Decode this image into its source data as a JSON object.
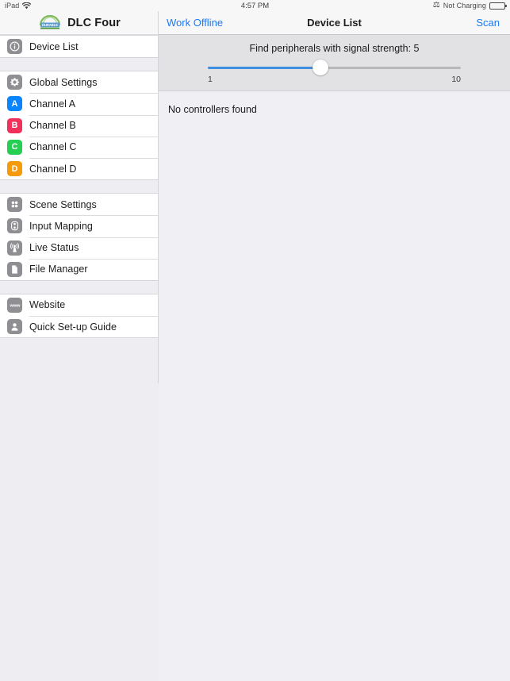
{
  "statusbar": {
    "device_label": "iPad",
    "wifi_icon": "wifi-icon",
    "time": "4:57 PM",
    "bluetooth_icon": "bluetooth-icon",
    "charging_status": "Not Charging",
    "battery_icon": "battery-full-icon"
  },
  "sidebar": {
    "brand": {
      "logo_icon": "durable-logo",
      "logo_text": "DURABLE",
      "title": "DLC Four"
    },
    "groups": [
      {
        "items": [
          {
            "label": "Device List",
            "icon": "info-circle-icon",
            "badge_type": "gray",
            "badge_color": "#8e8e93"
          }
        ]
      },
      {
        "items": [
          {
            "label": "Global Settings",
            "icon": "gear-icon",
            "badge_type": "gray",
            "badge_color": "#8e8e93"
          },
          {
            "label": "Channel A",
            "icon": "letter-a-icon",
            "badge_type": "letter",
            "badge_letter": "A",
            "badge_color": "#0a84ff"
          },
          {
            "label": "Channel B",
            "icon": "letter-b-icon",
            "badge_type": "letter",
            "badge_letter": "B",
            "badge_color": "#f0315b"
          },
          {
            "label": "Channel C",
            "icon": "letter-c-icon",
            "badge_type": "letter",
            "badge_letter": "C",
            "badge_color": "#25cf53"
          },
          {
            "label": "Channel D",
            "icon": "letter-d-icon",
            "badge_type": "letter",
            "badge_letter": "D",
            "badge_color": "#f59a0b"
          }
        ]
      },
      {
        "items": [
          {
            "label": "Scene Settings",
            "icon": "grid-dots-icon",
            "badge_type": "gray",
            "badge_color": "#8e8e93"
          },
          {
            "label": "Input Mapping",
            "icon": "sliders-toggle-icon",
            "badge_type": "gray",
            "badge_color": "#8e8e93"
          },
          {
            "label": "Live Status",
            "icon": "broadcast-antenna-icon",
            "badge_type": "gray",
            "badge_color": "#8e8e93"
          },
          {
            "label": "File Manager",
            "icon": "document-page-icon",
            "badge_type": "gray",
            "badge_color": "#8e8e93"
          }
        ]
      },
      {
        "items": [
          {
            "label": "Website",
            "icon": "www-globe-icon",
            "badge_type": "gray",
            "badge_color": "#8e8e93"
          },
          {
            "label": "Quick Set-up Guide",
            "icon": "person-portrait-icon",
            "badge_type": "gray",
            "badge_color": "#8e8e93"
          }
        ]
      }
    ]
  },
  "detail": {
    "navbar": {
      "left_button": "Work Offline",
      "title": "Device List",
      "right_button": "Scan",
      "accent_color": "#1a7af8"
    },
    "scan_panel": {
      "caption": "Find peripherals with signal strength: 5",
      "slider": {
        "value": 5,
        "min": 1,
        "max": 10,
        "min_label": "1",
        "max_label": "10",
        "fill_color": "#3e8ee0"
      }
    },
    "empty_message": "No controllers found"
  }
}
